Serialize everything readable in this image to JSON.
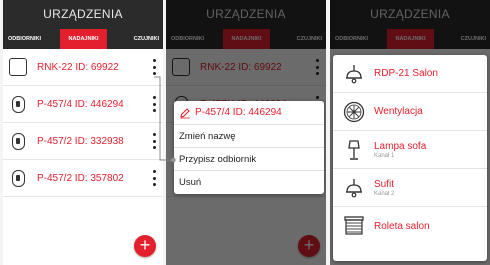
{
  "app": {
    "title": "URZĄDZENIA",
    "fab_label": "+"
  },
  "tabs": [
    {
      "label": "ODBIORNIKI",
      "active": false
    },
    {
      "label": "NADAJNIKI",
      "active": true
    },
    {
      "label": "CZUJNIKI",
      "active": false
    }
  ],
  "transmitters": [
    {
      "name": "RNK-22 ID: 69922",
      "icon": "square-device-icon"
    },
    {
      "name": "P-457/4 ID: 446294",
      "icon": "remote-icon"
    },
    {
      "name": "P-457/2 ID: 332938",
      "icon": "remote-icon"
    },
    {
      "name": "P-457/2 ID: 357802",
      "icon": "remote-icon"
    }
  ],
  "context_menu": {
    "title": "P-457/4 ID: 446294",
    "items": [
      "Zmień nazwę",
      "Przypisz odbiornik",
      "Usuń"
    ]
  },
  "receivers": [
    {
      "name": "RDP-21 Salon",
      "sub": "",
      "icon": "ceiling-lamp-icon"
    },
    {
      "name": "Wentylacja",
      "sub": "",
      "icon": "fan-icon"
    },
    {
      "name": "Lampa sofa",
      "sub": "Kanał 1",
      "icon": "floor-lamp-icon"
    },
    {
      "name": "Sufit",
      "sub": "Kanał 2",
      "icon": "ceiling-lamp-icon"
    },
    {
      "name": "Roleta salon",
      "sub": "",
      "icon": "roller-blind-icon"
    }
  ],
  "colors": {
    "accent": "#e5202e",
    "appbar": "#2b2b2b",
    "text": "#222222"
  }
}
